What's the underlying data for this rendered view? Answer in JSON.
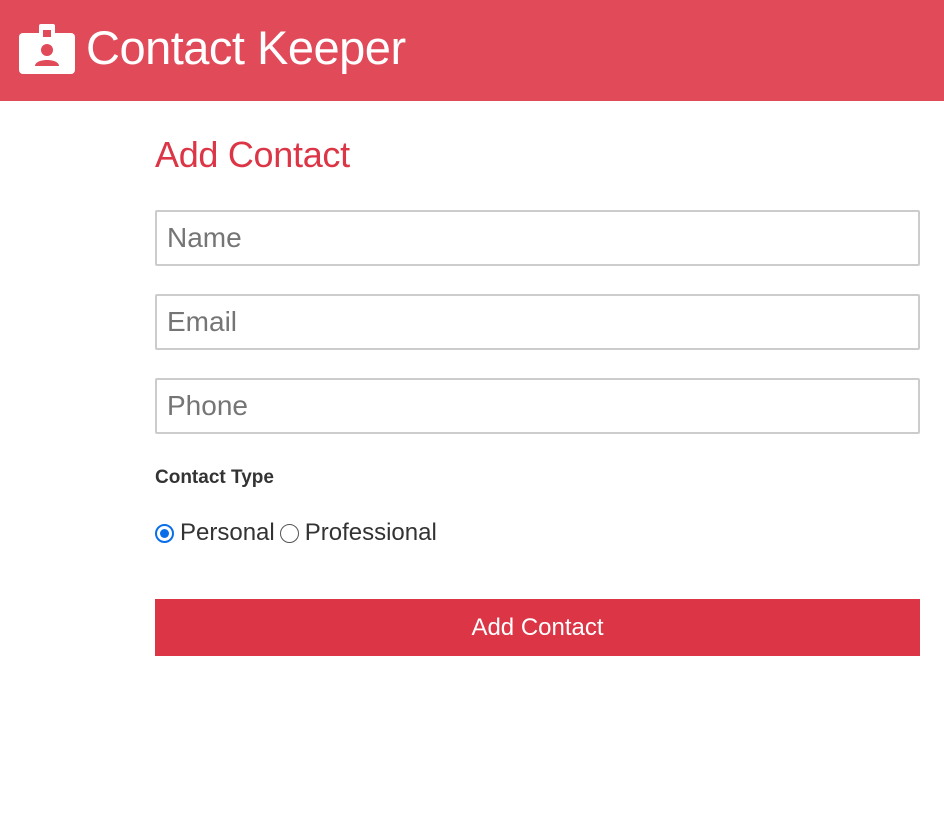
{
  "navbar": {
    "icon": "id-badge-icon",
    "title": "Contact Keeper",
    "background_color": "#e04a59"
  },
  "form": {
    "title": "Add Contact",
    "fields": {
      "name": {
        "placeholder": "Name",
        "value": ""
      },
      "email": {
        "placeholder": "Email",
        "value": ""
      },
      "phone": {
        "placeholder": "Phone",
        "value": ""
      }
    },
    "contact_type": {
      "heading": "Contact Type",
      "options": [
        {
          "label": "Personal",
          "checked": true
        },
        {
          "label": "Professional",
          "checked": false
        }
      ]
    },
    "submit_label": "Add Contact",
    "accent_color": "#dc3545"
  }
}
